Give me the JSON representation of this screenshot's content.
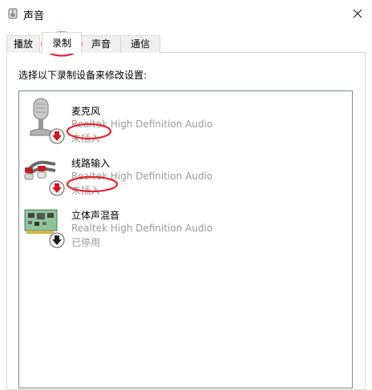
{
  "window": {
    "title": "声音"
  },
  "tabs": [
    {
      "label": "播放",
      "active": false
    },
    {
      "label": "录制",
      "active": true
    },
    {
      "label": "声音",
      "active": false
    },
    {
      "label": "通信",
      "active": false
    }
  ],
  "recording": {
    "instruction": "选择以下录制设备来修改设置:",
    "devices": [
      {
        "name": "麦克风",
        "description": "Realtek High Definition Audio",
        "status": "未插入",
        "icon": "microphone-icon",
        "badge": "red-down-arrow"
      },
      {
        "name": "线路输入",
        "description": "Realtek High Definition Audio",
        "status": "未插入",
        "icon": "rca-cable-icon",
        "badge": "red-down-arrow"
      },
      {
        "name": "立体声混音",
        "description": "Realtek High Definition Audio",
        "status": "已停用",
        "icon": "sound-card-icon",
        "badge": "black-down-arrow"
      }
    ]
  },
  "colors": {
    "annotation": "#e3262e",
    "disabled_text": "#9a9a9a",
    "border": "#d9d9d9",
    "listbox_border": "#828790"
  }
}
